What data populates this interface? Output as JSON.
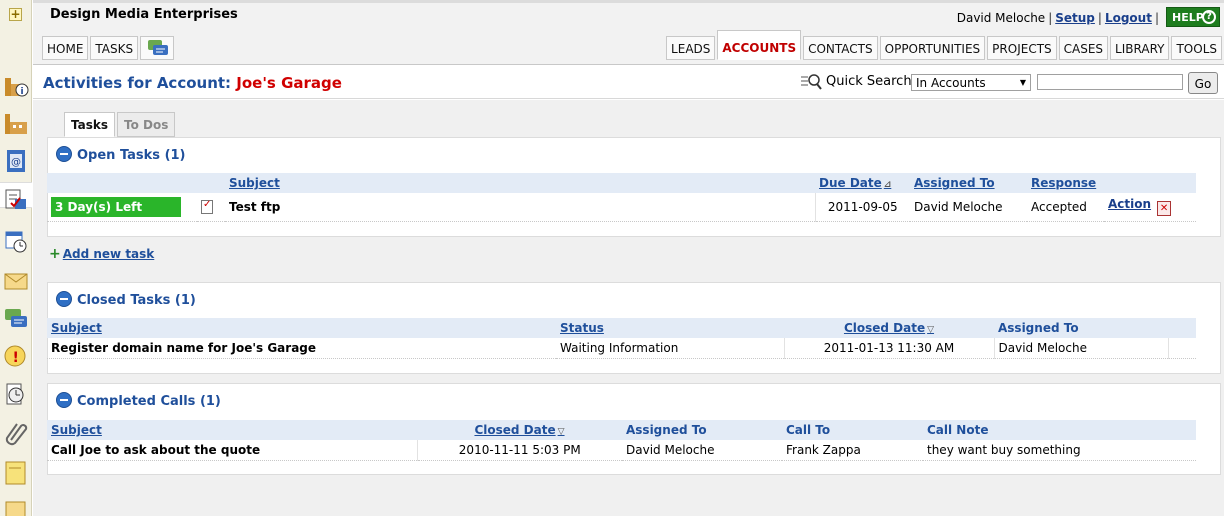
{
  "header": {
    "company": "Design Media Enterprises",
    "user_name": "David Meloche",
    "setup_label": "Setup",
    "logout_label": "Logout",
    "help_label": "HELP",
    "help_icon": "?"
  },
  "nav": {
    "home": "HOME",
    "tasks": "TASKS",
    "leads": "LEADS",
    "accounts": "ACCOUNTS",
    "contacts": "CONTACTS",
    "opportunities": "OPPORTUNITIES",
    "projects": "PROJECTS",
    "cases": "CASES",
    "library": "LIBRARY",
    "tools": "TOOLS"
  },
  "page": {
    "title_prefix": "Activities for Account:",
    "account_name": "Joe's Garage"
  },
  "quick_search": {
    "label": "Quick Search",
    "scope": "In Accounts",
    "query": "",
    "go_label": "Go"
  },
  "subtabs": {
    "tasks": "Tasks",
    "todos": "To Dos"
  },
  "open_tasks": {
    "title": "Open Tasks (1)",
    "headers": {
      "subject": "Subject",
      "due_date": "Due Date",
      "assigned_to": "Assigned To",
      "response": "Response"
    },
    "rows": [
      {
        "days_left": "3 Day(s) Left",
        "subject": "Test ftp",
        "due_date": "2011-09-05",
        "assigned_to": "David Meloche",
        "response": "Accepted",
        "action": "Action"
      }
    ]
  },
  "add_task_label": "Add new task",
  "closed_tasks": {
    "title": "Closed Tasks (1)",
    "headers": {
      "subject": "Subject",
      "status": "Status",
      "closed_date": "Closed Date",
      "assigned_to": "Assigned To"
    },
    "rows": [
      {
        "subject": "Register domain name for Joe's Garage",
        "status": "Waiting Information",
        "closed_date": "2011-01-13 11:30 AM",
        "assigned_to": "David Meloche"
      }
    ]
  },
  "completed_calls": {
    "title": "Completed Calls (1)",
    "headers": {
      "subject": "Subject",
      "closed_date": "Closed Date",
      "assigned_to": "Assigned To",
      "call_to": "Call To",
      "call_note": "Call Note"
    },
    "rows": [
      {
        "subject": "Call Joe to ask about the quote",
        "closed_date": "2010-11-11 5:03 PM",
        "assigned_to": "David Meloche",
        "call_to": "Frank Zappa",
        "call_note": "they want buy something"
      }
    ]
  },
  "colors": {
    "title_blue": "#1f4f9b",
    "account_red": "#d00000",
    "days_left_green": "#2ab52a",
    "help_green": "#1e7d1e"
  },
  "icons": {
    "rail": [
      "account-info-icon",
      "accounts-icon",
      "address-book-icon",
      "activities-icon",
      "calendar-icon",
      "email-icon",
      "chat-icon",
      "alert-icon",
      "history-icon",
      "attachment-icon",
      "notes-icon"
    ]
  }
}
